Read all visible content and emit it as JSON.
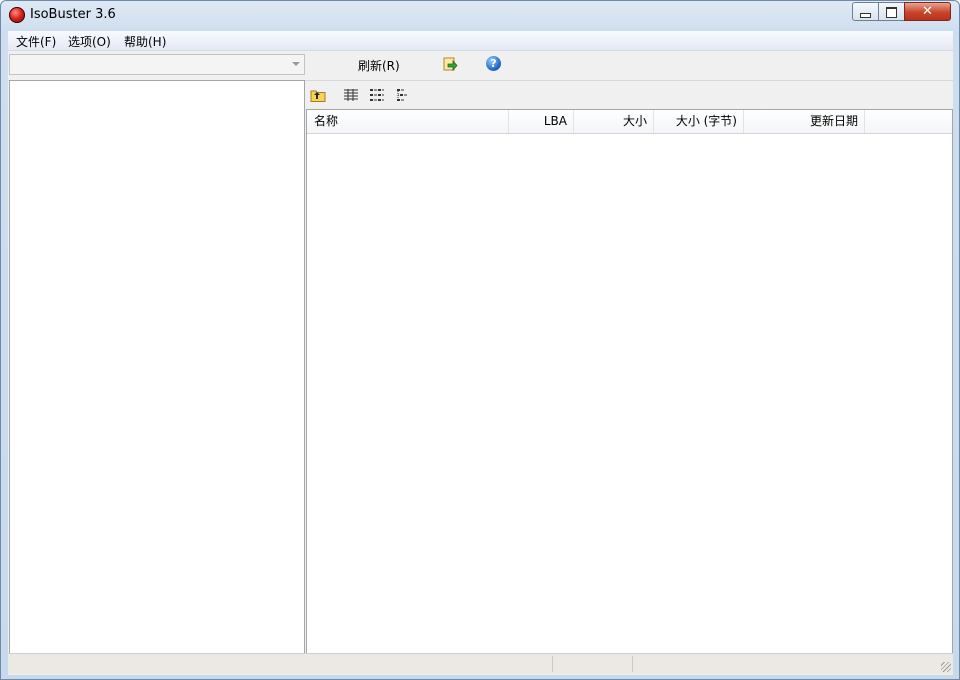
{
  "window": {
    "title": "IsoBuster 3.6"
  },
  "menu": {
    "file": "文件(F)",
    "options": "选项(O)",
    "help": "帮助(H)"
  },
  "toolbar": {
    "drive_combo_value": "",
    "refresh_label": "刷新(R)",
    "export_icon": "export-green-arrow-icon",
    "help_icon": "help-question-icon"
  },
  "list_toolbar": {
    "icons": [
      "folder-up-icon",
      "details-view-icon",
      "list-view-icon",
      "tree-view-icon"
    ]
  },
  "list": {
    "columns": [
      "名称",
      "LBA",
      "大小",
      "大小 (字节)",
      "更新日期"
    ],
    "rows": []
  },
  "colors": {
    "title_bar": "#cfdeef",
    "close_button": "#c7452b",
    "pane_border": "#a6a6a6"
  }
}
